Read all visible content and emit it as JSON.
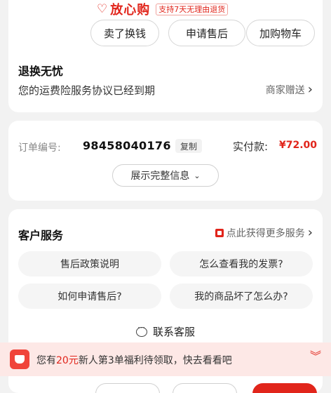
{
  "top_card": {
    "brand_logo_text": "放心购",
    "brand_tag": "支持7天无理由退货",
    "actions": [
      {
        "label": "卖了换钱"
      },
      {
        "label": "申请售后"
      },
      {
        "label": "加购物车"
      }
    ],
    "section_title": "退换无忧",
    "section_subtitle": "您的运费险服务协议已经到期",
    "section_link": "商家赠送"
  },
  "order": {
    "order_no_label": "订单编号:",
    "order_no": "98458040176",
    "copy_label": "复制",
    "paid_label": "实付款:",
    "paid_value": "¥72.00",
    "expand_label": "展示完整信息"
  },
  "service": {
    "title": "客户服务",
    "more_label": "点此获得更多服务",
    "faqs": [
      {
        "label": "售后政策说明"
      },
      {
        "label": "怎么查看我的发票?"
      },
      {
        "label": "如何申请售后?"
      },
      {
        "label": "我的商品坏了怎么办?"
      }
    ],
    "contact_label": "联系客服"
  },
  "banner": {
    "text_before": "您有",
    "highlight": "20元",
    "text_after": "新人第3单福利待领取，快去看看吧"
  },
  "colors": {
    "accent": "#e1251b",
    "banner_bg": "#fde8e6",
    "page_bg": "#f2f2f2"
  }
}
